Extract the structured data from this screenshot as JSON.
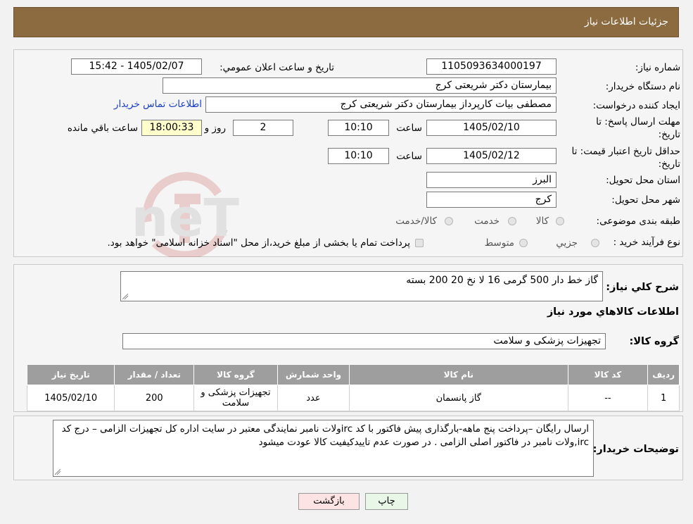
{
  "header": {
    "title": "جزئیات اطلاعات نیاز"
  },
  "watermark": {
    "text": "AriaTender.neT"
  },
  "form": {
    "need_number_label": "شماره نیاز:",
    "need_number": "1105093634000197",
    "announce_label": "تاريخ و ساعت اعلان عمومي:",
    "announce_value": "1405/02/07 - 15:42",
    "buyer_label": "نام دستگاه خريدار:",
    "buyer_value": "بیمارستان دکتر شریعتی کرج",
    "creator_label": "ايجاد کننده درخواست:",
    "creator_value": "مصطفی بیات کارپرداز بیمارستان دکتر شریعتی کرج",
    "contact_link": "اطلاعات تماس خريدار",
    "deadline_label_1": "مهلت ارسال پاسخ: تا",
    "deadline_label_2": "تاريخ:",
    "deadline_date": "1405/02/10",
    "time_label": "ساعت",
    "deadline_time": "10:10",
    "days_value": "2",
    "days_label": "روز و",
    "remaining_time": "18:00:33",
    "remaining_label": "ساعت باقي مانده",
    "validity_label_1": "حداقل تاريخ اعتبار قيمت: تا",
    "validity_label_2": "تاريخ:",
    "validity_date": "1405/02/12",
    "validity_time_label": "ساعت",
    "validity_time": "10:10",
    "province_label": "استان محل تحويل:",
    "province_value": "البرز",
    "city_label": "شهر محل تحويل:",
    "city_value": "کرج",
    "category_label": "طبقه بندی موضوعی:",
    "category_options": [
      "کالا",
      "خدمت",
      "کالا/خدمت"
    ],
    "process_label": "نوع فرآيند خريد :",
    "process_options": [
      "جزيي",
      "متوسط"
    ],
    "process_note": "پرداخت تمام يا بخشی از مبلغ خريد،از محل \"اسناد خزانه اسلامی\" خواهد بود."
  },
  "description": {
    "label": "شرح کلي نياز:",
    "value": "گاز خط دار 500 گرمی 16 لا نخ 20       200 بسته"
  },
  "goods": {
    "section_title": "اطلاعات کالاهاي مورد نياز",
    "group_label": "گروه کالا:",
    "group_value": "تجهیزات پزشکی و سلامت"
  },
  "table": {
    "headers": [
      "رديف",
      "کد کالا",
      "نام کالا",
      "واحد شمارش",
      "گروه کالا",
      "تعداد / مقدار",
      "تاريخ نياز"
    ],
    "rows": [
      [
        "1",
        "--",
        "گاز پانسمان",
        "عدد",
        "تجهیزات پزشکی و سلامت",
        "200",
        "1405/02/10"
      ]
    ]
  },
  "buyer_notes": {
    "label": "توضيحات خريدار:",
    "value": "ارسال رایگان –پرداخت پنج  ماهه-بارگذاری  پیش فاکتور با کد ircولات نامبر نمایندگی معتبر در سایت اداره کل تجهیزات الزامی – درج کد irc,ولات نامبر در فاکتور اصلی الزامی . در صورت عدم تاییدکیفیت کالا عودت میشود"
  },
  "buttons": {
    "print": "چاپ",
    "back": "بازگشت"
  },
  "colors": {
    "header": "#8b6b3f",
    "table_header": "#9e9e9e",
    "link": "#1a3fc2",
    "back_button": "#fde3e3",
    "print_button": "#e9f7e9"
  }
}
